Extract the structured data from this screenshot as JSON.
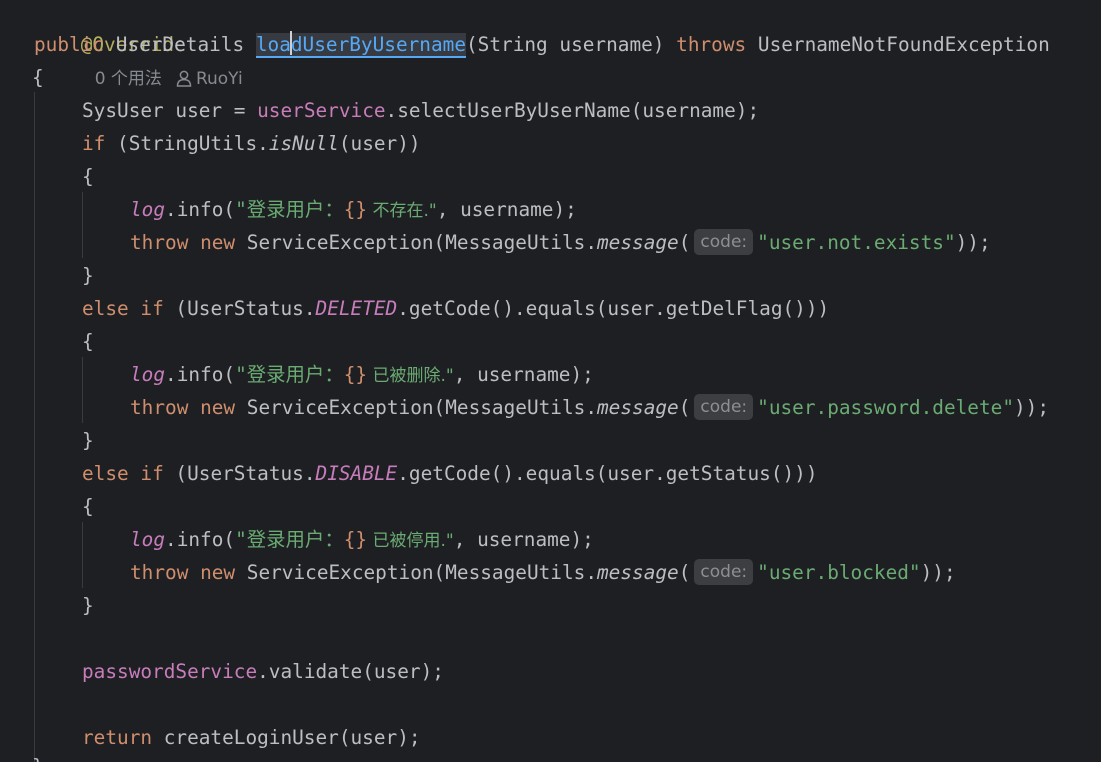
{
  "editor": {
    "annotation": "@Override",
    "usages_hint": "0 个用法",
    "author_hint": "RuoYi",
    "hint_label": "code:",
    "signature": {
      "kw_public": "public",
      "return_type": "UserDetails",
      "method_prefix": "loa",
      "method_suffix": "dUserByUsername",
      "params": "(String username)",
      "kw_throws": "throws",
      "exception": "UsernameNotFoundException"
    },
    "lines": {
      "l3": "{",
      "l4_type": "SysUser user = ",
      "l4_field": "userService",
      "l4_rest": ".selectUserByUserName(username);",
      "l5_kw": "if",
      "l5_a": " (StringUtils.",
      "l5_method": "isNull",
      "l5_b": "(user))",
      "l6": "{",
      "l7_log": "log",
      "l7_a": ".info(",
      "l7_str_a": "\"登录用户：",
      "l7_brace": "{}",
      "l7_str_b": " 不存在.\"",
      "l7_b": ", username);",
      "l8_throw": "throw",
      "l8_new": "new",
      "l8_a": " ServiceException(MessageUtils.",
      "l8_method": "message",
      "l8_b": "(",
      "l8_str": "\"user.not.exists\"",
      "l8_c": "));",
      "l9": "}",
      "l10_else": "else",
      "l10_if": "if",
      "l10_a": " (UserStatus.",
      "l10_const": "DELETED",
      "l10_b": ".getCode().equals(user.getDelFlag()))",
      "l11": "{",
      "l12_log": "log",
      "l12_a": ".info(",
      "l12_str_a": "\"登录用户：",
      "l12_brace": "{}",
      "l12_str_b": " 已被删除.\"",
      "l12_b": ", username);",
      "l13_throw": "throw",
      "l13_new": "new",
      "l13_a": " ServiceException(MessageUtils.",
      "l13_method": "message",
      "l13_b": "(",
      "l13_str": "\"user.password.delete\"",
      "l13_c": "));",
      "l14": "}",
      "l15_else": "else",
      "l15_if": "if",
      "l15_a": " (UserStatus.",
      "l15_const": "DISABLE",
      "l15_b": ".getCode().equals(user.getStatus()))",
      "l16": "{",
      "l17_log": "log",
      "l17_a": ".info(",
      "l17_str_a": "\"登录用户：",
      "l17_brace": "{}",
      "l17_str_b": " 已被停用.\"",
      "l17_b": ", username);",
      "l18_throw": "throw",
      "l18_new": "new",
      "l18_a": " ServiceException(MessageUtils.",
      "l18_method": "message",
      "l18_b": "(",
      "l18_str": "\"user.blocked\"",
      "l18_c": "));",
      "l19": "}",
      "l21_field": "passwordService",
      "l21_rest": ".validate(user);",
      "l23_kw": "return",
      "l23_rest": " createLoginUser(user);",
      "l24": "}"
    }
  },
  "colors": {
    "background": "#1e1f22",
    "text": "#bcbec4",
    "keyword": "#cf8e6d",
    "string": "#6aab73",
    "field": "#c77dbb",
    "annotation": "#b3ae60",
    "method_declaration": "#56a8f5"
  }
}
